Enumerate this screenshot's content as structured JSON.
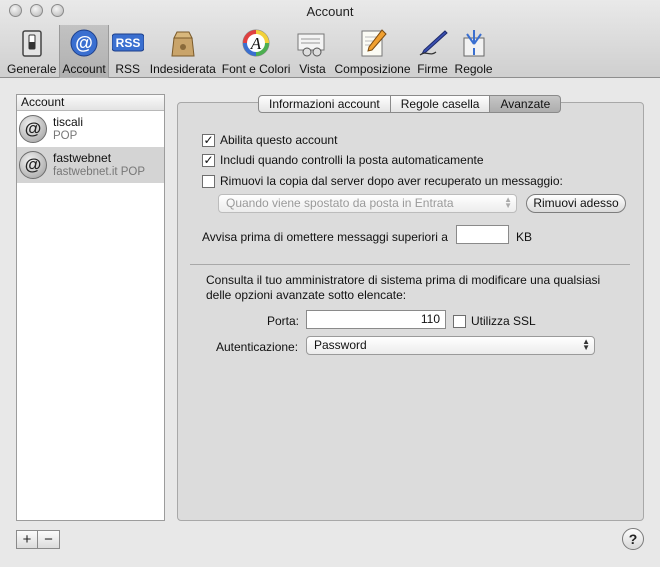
{
  "window": {
    "title": "Account"
  },
  "toolbar": {
    "items": [
      {
        "label": "Generale",
        "icon": "switch-icon"
      },
      {
        "label": "Account",
        "icon": "at-sign-icon"
      },
      {
        "label": "RSS",
        "icon": "rss-icon"
      },
      {
        "label": "Indesiderata",
        "icon": "junk-bag-icon"
      },
      {
        "label": "Font e Colori",
        "icon": "font-color-icon"
      },
      {
        "label": "Vista",
        "icon": "view-icon"
      },
      {
        "label": "Composizione",
        "icon": "compose-pencil-icon"
      },
      {
        "label": "Firme",
        "icon": "signature-pen-icon"
      },
      {
        "label": "Regole",
        "icon": "rules-icon"
      }
    ],
    "selected": "Account",
    "rss_badge": "RSS",
    "accent_color": "#3a6fd0"
  },
  "accounts": {
    "header": "Account",
    "items": [
      {
        "name": "tiscali",
        "type": "POP"
      },
      {
        "name": "fastwebnet",
        "type": "fastwebnet.it POP"
      }
    ],
    "selected": "fastwebnet",
    "add_label": "+",
    "remove_label": "−"
  },
  "tabs": {
    "items": [
      "Informazioni account",
      "Regole casella",
      "Avanzate"
    ],
    "active": "Avanzate"
  },
  "advanced": {
    "enable_account": {
      "label": "Abilita questo account",
      "checked": true
    },
    "include_auto_check": {
      "label": "Includi quando controlli la posta automaticamente",
      "checked": true
    },
    "remove_copy": {
      "label": "Rimuovi la copia dal server dopo aver recuperato un messaggio:",
      "checked": false
    },
    "remove_when_select": {
      "value": "Quando viene spostato da posta in Entrata",
      "enabled": false
    },
    "remove_now_button": "Rimuovi adesso",
    "warn_size_label": "Avvisa prima di omettere messaggi superiori a",
    "warn_size_value": "",
    "warn_size_unit": "KB",
    "admin_note": "Consulta il tuo amministratore di sistema prima di modificare una qualsiasi delle opzioni avanzate sotto elencate:",
    "port_label": "Porta:",
    "port_value": "110",
    "ssl": {
      "label": "Utilizza SSL",
      "checked": false
    },
    "auth_label": "Autenticazione:",
    "auth_value": "Password"
  },
  "help_label": "?"
}
